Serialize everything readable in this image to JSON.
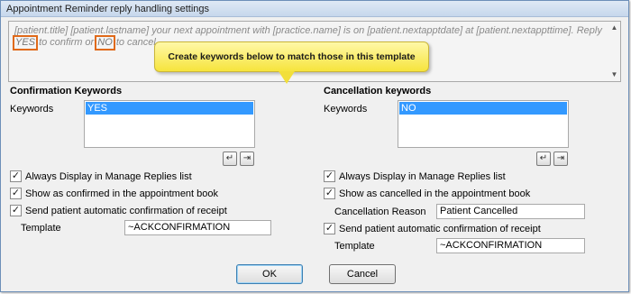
{
  "window": {
    "title": "Appointment Reminder reply handling settings"
  },
  "preview": {
    "text_before": "[patient.title] [patient.lastname] your next appointment with [practice.name] is on [patient.nextapptdate] at [patient.nextappttime]. Reply ",
    "confirm_word": "YES",
    "text_middle": " to confirm or ",
    "cancel_word": "NO",
    "text_after": " to cancel."
  },
  "callout": {
    "text": "Create keywords below to match those in this template"
  },
  "confirmation": {
    "title": "Confirmation Keywords",
    "keywords_label": "Keywords",
    "keywords": [
      "YES"
    ],
    "always_display": "Always Display in Manage Replies list",
    "show_as": "Show as confirmed in the appointment book",
    "send_receipt": "Send patient automatic confirmation of receipt",
    "template_label": "Template",
    "template_value": "~ACKCONFIRMATION"
  },
  "cancellation": {
    "title": "Cancellation keywords",
    "keywords_label": "Keywords",
    "keywords": [
      "NO"
    ],
    "always_display": "Always Display in Manage Replies list",
    "show_as": "Show as cancelled in the appointment book",
    "reason_label": "Cancellation Reason",
    "reason_value": "Patient Cancelled",
    "send_receipt": "Send patient automatic confirmation of receipt",
    "template_label": "Template",
    "template_value": "~ACKCONFIRMATION"
  },
  "buttons": {
    "ok": "OK",
    "cancel": "Cancel"
  },
  "icons": {
    "add": "add-keyword-icon",
    "remove": "remove-keyword-icon",
    "check": "checkmark-icon"
  },
  "colors": {
    "highlight": "#3399ff",
    "callout": "#f6e43c",
    "marker": "#e06a1a"
  }
}
